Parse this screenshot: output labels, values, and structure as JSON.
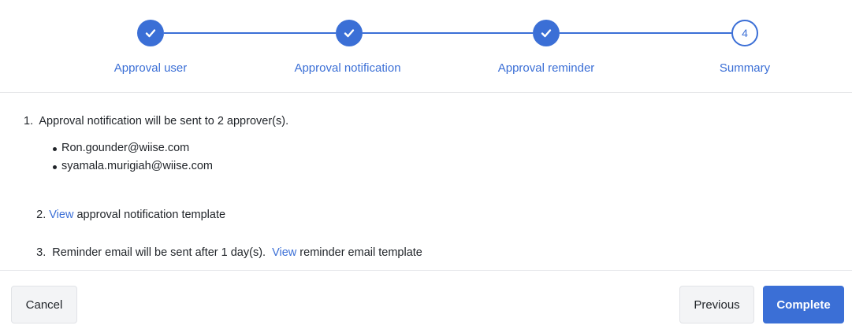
{
  "stepper": {
    "steps": [
      {
        "label": "Approval user",
        "state": "done",
        "icon": "check-icon"
      },
      {
        "label": "Approval notification",
        "state": "done",
        "icon": "check-icon"
      },
      {
        "label": "Approval reminder",
        "state": "done",
        "icon": "check-icon"
      },
      {
        "label": "Summary",
        "state": "current",
        "number": "4"
      }
    ],
    "accent_color": "#3b6fd6"
  },
  "summary": {
    "item1": {
      "text": "1.  Approval notification will be sent to 2 approver(s).",
      "approvers": [
        "Ron.gounder@wiise.com",
        "syamala.murigiah@wiise.com"
      ]
    },
    "item2": {
      "prefix": "2. ",
      "link": "View",
      "suffix": " approval notification template"
    },
    "item3": {
      "prefix": "3.  Reminder email will be sent after 1 day(s).  ",
      "link": "View",
      "suffix": " reminder email template"
    }
  },
  "footer": {
    "cancel_label": "Cancel",
    "previous_label": "Previous",
    "complete_label": "Complete"
  }
}
